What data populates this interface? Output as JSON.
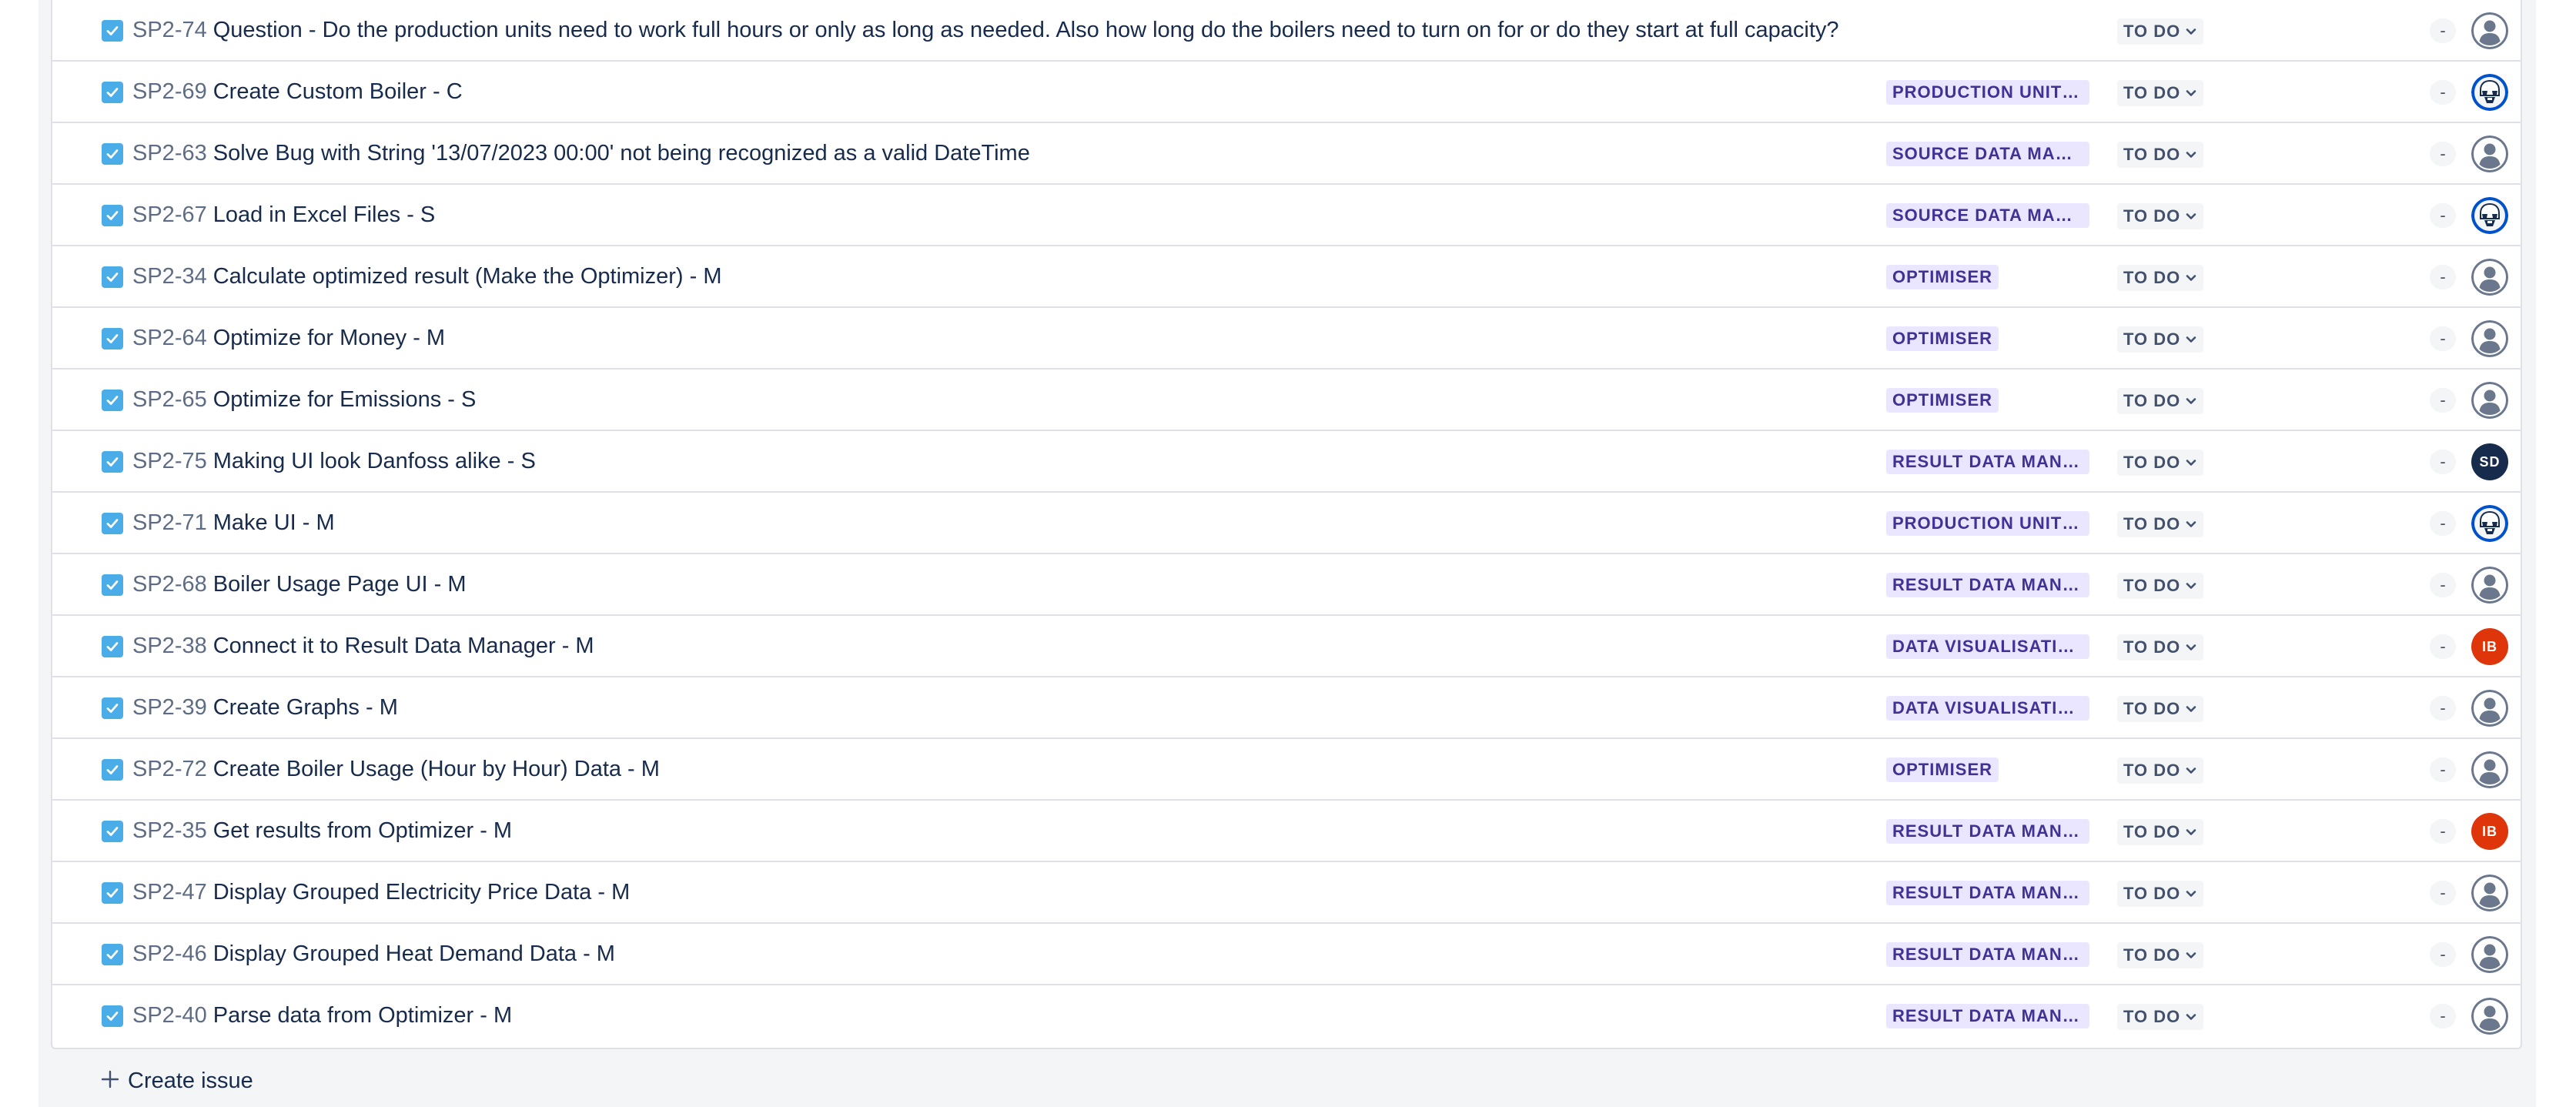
{
  "backlog": {
    "issues": [
      {
        "key": "SP2-74",
        "summary": "Question - Do the production units need to work full hours or only as long as needed. Also how long do the boilers need to turn on for or do they start at full capacity?",
        "epic": "",
        "status": "TO DO",
        "estimate": "-",
        "assignee": {
          "kind": "unassigned"
        }
      },
      {
        "key": "SP2-69",
        "summary": "Create Custom Boiler - C",
        "epic": "PRODUCTION UNIT CONFIGURATION",
        "status": "TO DO",
        "estimate": "-",
        "assignee": {
          "kind": "trooper"
        }
      },
      {
        "key": "SP2-63",
        "summary": "Solve Bug with String '13/07/2023 00:00' not being recognized as a valid DateTime",
        "epic": "SOURCE DATA MANAGER",
        "status": "TO DO",
        "estimate": "-",
        "assignee": {
          "kind": "unassigned"
        }
      },
      {
        "key": "SP2-67",
        "summary": "Load in Excel Files - S",
        "epic": "SOURCE DATA MANAGER",
        "status": "TO DO",
        "estimate": "-",
        "assignee": {
          "kind": "trooper"
        }
      },
      {
        "key": "SP2-34",
        "summary": "Calculate optimized result (Make the Optimizer) - M",
        "epic": "OPTIMISER",
        "status": "TO DO",
        "estimate": "-",
        "assignee": {
          "kind": "unassigned"
        }
      },
      {
        "key": "SP2-64",
        "summary": "Optimize for Money - M",
        "epic": "OPTIMISER",
        "status": "TO DO",
        "estimate": "-",
        "assignee": {
          "kind": "unassigned"
        }
      },
      {
        "key": "SP2-65",
        "summary": "Optimize for Emissions - S",
        "epic": "OPTIMISER",
        "status": "TO DO",
        "estimate": "-",
        "assignee": {
          "kind": "unassigned"
        }
      },
      {
        "key": "SP2-75",
        "summary": "Making UI look Danfoss alike - S",
        "epic": "RESULT DATA MANAGER",
        "status": "TO DO",
        "estimate": "-",
        "assignee": {
          "kind": "initials",
          "initials": "SD",
          "color": "#172b4d"
        }
      },
      {
        "key": "SP2-71",
        "summary": "Make UI - M",
        "epic": "PRODUCTION UNIT CONFIGURATION",
        "status": "TO DO",
        "estimate": "-",
        "assignee": {
          "kind": "trooper"
        }
      },
      {
        "key": "SP2-68",
        "summary": "Boiler Usage Page UI - M",
        "epic": "RESULT DATA MANAGER",
        "status": "TO DO",
        "estimate": "-",
        "assignee": {
          "kind": "unassigned"
        }
      },
      {
        "key": "SP2-38",
        "summary": "Connect it to Result Data Manager - M",
        "epic": "DATA VISUALISATION",
        "status": "TO DO",
        "estimate": "-",
        "assignee": {
          "kind": "initials",
          "initials": "IB",
          "color": "#de350b"
        }
      },
      {
        "key": "SP2-39",
        "summary": "Create Graphs - M",
        "epic": "DATA VISUALISATION",
        "status": "TO DO",
        "estimate": "-",
        "assignee": {
          "kind": "unassigned"
        }
      },
      {
        "key": "SP2-72",
        "summary": "Create Boiler Usage (Hour by Hour) Data - M",
        "epic": "OPTIMISER",
        "status": "TO DO",
        "estimate": "-",
        "assignee": {
          "kind": "unassigned"
        }
      },
      {
        "key": "SP2-35",
        "summary": "Get results from Optimizer - M",
        "epic": "RESULT DATA MANAGER",
        "status": "TO DO",
        "estimate": "-",
        "assignee": {
          "kind": "initials",
          "initials": "IB",
          "color": "#de350b"
        }
      },
      {
        "key": "SP2-47",
        "summary": "Display Grouped Electricity Price Data - M",
        "epic": "RESULT DATA MANAGER",
        "status": "TO DO",
        "estimate": "-",
        "assignee": {
          "kind": "unassigned"
        }
      },
      {
        "key": "SP2-46",
        "summary": "Display Grouped Heat Demand Data - M",
        "epic": "RESULT DATA MANAGER",
        "status": "TO DO",
        "estimate": "-",
        "assignee": {
          "kind": "unassigned"
        }
      },
      {
        "key": "SP2-40",
        "summary": "Parse data from Optimizer - M",
        "epic": "RESULT DATA MANAGER",
        "status": "TO DO",
        "estimate": "-",
        "assignee": {
          "kind": "unassigned"
        }
      }
    ],
    "create_issue_label": "Create issue"
  },
  "icons": {
    "issue_type": "task-checkbox-icon",
    "status_dropdown": "chevron-down-icon",
    "unassigned": "user-avatar-icon",
    "trooper": "stormtrooper-avatar-icon",
    "create": "plus-icon"
  },
  "colors": {
    "task_icon": "#4bade8",
    "epic_bg": "#eae6ff",
    "epic_text": "#403294",
    "key_text": "#5e6c84",
    "unassigned_avatar": "#6b778c",
    "trooper_avatar_bg": "#0052cc"
  }
}
